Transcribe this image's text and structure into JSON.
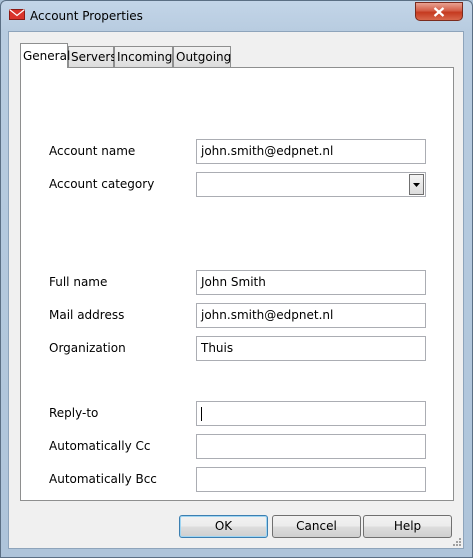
{
  "window": {
    "title": "Account Properties",
    "icon": "envelope-red-icon",
    "close_icon": "close-x-icon"
  },
  "tabs": [
    {
      "label": "General",
      "active": true
    },
    {
      "label": "Servers",
      "active": false
    },
    {
      "label": "Incoming",
      "active": false
    },
    {
      "label": "Outgoing",
      "active": false
    }
  ],
  "form": {
    "account_name": {
      "label": "Account name",
      "value": "john.smith@edpnet.nl"
    },
    "account_category": {
      "label": "Account category",
      "value": ""
    },
    "full_name": {
      "label": "Full name",
      "value": "John Smith"
    },
    "mail_address": {
      "label": "Mail address",
      "value": "john.smith@edpnet.nl"
    },
    "organization": {
      "label": "Organization",
      "value": "Thuis"
    },
    "reply_to": {
      "label": "Reply-to",
      "value": ""
    },
    "auto_cc": {
      "label": "Automatically Cc",
      "value": ""
    },
    "auto_bcc": {
      "label": "Automatically Bcc",
      "value": ""
    }
  },
  "buttons": {
    "ok": "OK",
    "cancel": "Cancel",
    "help": "Help"
  },
  "colors": {
    "close_button": "#c53a20",
    "frame": "#b8cce0",
    "default_button_border": "#3c7fb1"
  }
}
